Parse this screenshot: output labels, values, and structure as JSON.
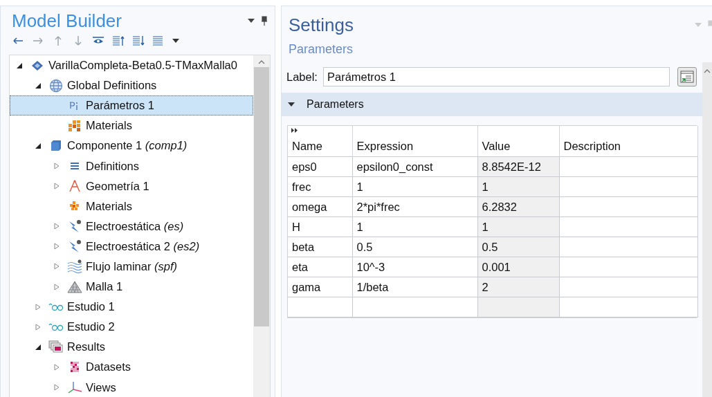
{
  "model_builder": {
    "title": "Model Builder",
    "toolbar": [
      {
        "kind": "back",
        "disabled": false
      },
      {
        "kind": "forward",
        "disabled": true
      },
      {
        "kind": "up",
        "disabled": true
      },
      {
        "kind": "down",
        "disabled": true
      },
      {
        "kind": "eye",
        "disabled": false
      },
      {
        "kind": "collapse",
        "disabled": false
      },
      {
        "kind": "expand",
        "disabled": false
      },
      {
        "kind": "list",
        "disabled": false
      }
    ],
    "tree": [
      {
        "label": "VarillaCompleta-Beta0.5-TMaxMalla0",
        "kind": "model",
        "expanded": true,
        "selected": false,
        "children": [
          {
            "label": "Global Definitions",
            "kind": "globe",
            "expanded": true,
            "selected": false,
            "children": [
              {
                "label": "Parámetros 1",
                "kind": "param",
                "selected": true
              },
              {
                "label": "Materials",
                "kind": "materials",
                "selected": false
              }
            ]
          },
          {
            "label": "Componente 1 *(comp1)*",
            "kind": "component",
            "expanded": true,
            "selected": false,
            "children": [
              {
                "label": "Definitions",
                "kind": "definitions",
                "expanded": false,
                "selected": false
              },
              {
                "label": "Geometría 1",
                "kind": "geometry",
                "expanded": false,
                "selected": false
              },
              {
                "label": "Materials",
                "kind": "materials-small",
                "selected": false
              },
              {
                "label": "Electroestática *(es)*",
                "kind": "physics",
                "expanded": false,
                "selected": false
              },
              {
                "label": "Electroestática 2 *(es2)*",
                "kind": "physics",
                "expanded": false,
                "selected": false
              },
              {
                "label": "Flujo laminar *(spf)*",
                "kind": "flow",
                "expanded": false,
                "selected": false
              },
              {
                "label": "Malla 1",
                "kind": "mesh",
                "expanded": false,
                "selected": false
              }
            ]
          },
          {
            "label": "Estudio 1",
            "kind": "study",
            "expanded": false,
            "selected": false
          },
          {
            "label": "Estudio 2",
            "kind": "study",
            "expanded": false,
            "selected": false
          },
          {
            "label": "Results",
            "kind": "results",
            "expanded": true,
            "selected": false,
            "children": [
              {
                "label": "Datasets",
                "kind": "datasets",
                "expanded": false,
                "selected": false
              },
              {
                "label": "Views",
                "kind": "views",
                "expanded": false,
                "selected": false
              }
            ]
          }
        ]
      }
    ]
  },
  "settings": {
    "title": "Settings",
    "subtitle": "Parameters",
    "label_field": {
      "label": "Label:",
      "value": "Parámetros 1"
    },
    "section": {
      "title": "Parameters",
      "expanded": true
    },
    "table": {
      "columns": [
        "Name",
        "Expression",
        "Value",
        "Description"
      ],
      "rows": [
        {
          "name": "eps0",
          "expression": "epsilon0_const",
          "value": "8.8542E-12"
        },
        {
          "name": "frec",
          "expression": "1",
          "value": "1"
        },
        {
          "name": "omega",
          "expression": "2*pi*frec",
          "value": "6.2832"
        },
        {
          "name": "H",
          "expression": "1",
          "value": "1"
        },
        {
          "name": "beta",
          "expression": "0.5",
          "value": "0.5"
        },
        {
          "name": "eta",
          "expression": "10^-3",
          "value": "0.001"
        },
        {
          "name": "gama",
          "expression": "1/beta",
          "value": "2"
        }
      ]
    }
  }
}
